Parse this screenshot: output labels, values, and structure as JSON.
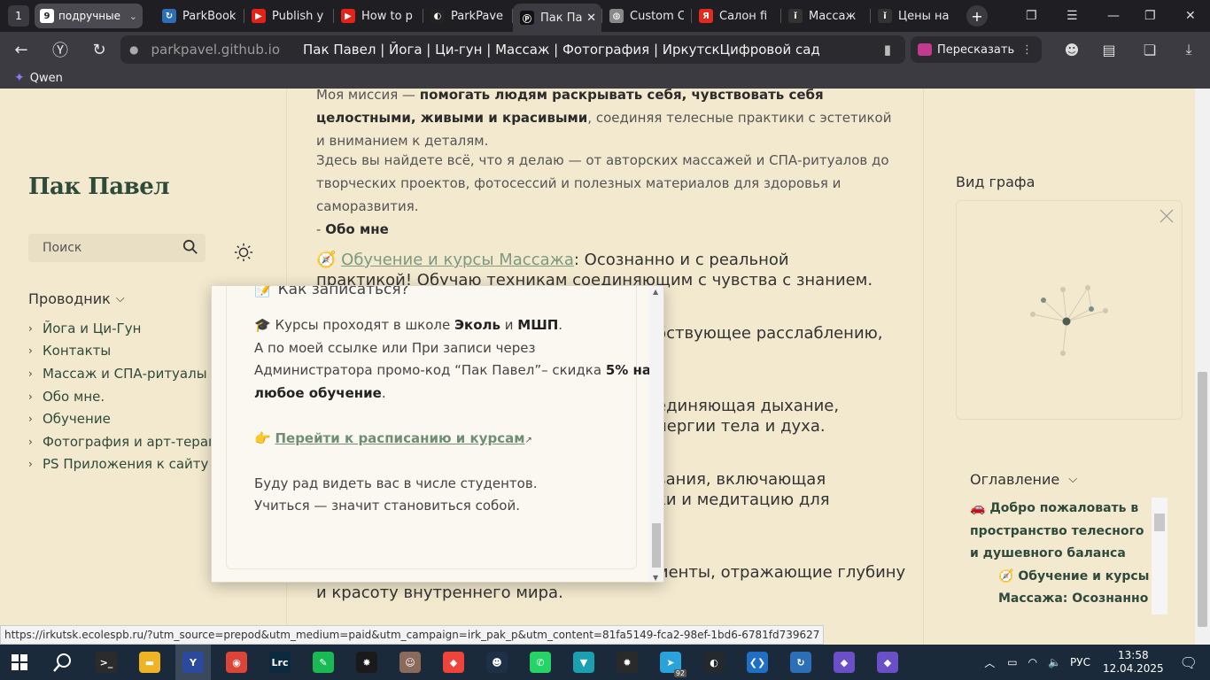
{
  "browser": {
    "tab_counter": "1",
    "group": {
      "count": "9",
      "label": "подручные"
    },
    "tabs": [
      {
        "title": "ParkBook",
        "fav_color": "#2d6fb7",
        "fav": "↻",
        "active": false
      },
      {
        "title": "Publish y",
        "fav_color": "#e62117",
        "fav": "▶",
        "active": false
      },
      {
        "title": "How to p",
        "fav_color": "#e62117",
        "fav": "▶",
        "active": false
      },
      {
        "title": "ParkPave",
        "fav_color": "#222",
        "fav": "◐",
        "active": false
      },
      {
        "title": "Пак Па",
        "fav_color": "#111",
        "fav": "Ⓟ",
        "active": true
      },
      {
        "title": "Custom C",
        "fav_color": "#888",
        "fav": "◍",
        "active": false
      },
      {
        "title": "Салон fi",
        "fav_color": "#e32a1f",
        "fav": "Я",
        "active": false
      },
      {
        "title": "Массаж",
        "fav_color": "#333",
        "fav": "ǐ",
        "active": false
      },
      {
        "title": "Цены на",
        "fav_color": "#333",
        "fav": "ǐ",
        "active": false
      }
    ],
    "address": {
      "host": "parkpavel.github.io",
      "page_title": "Пак Павел | Йога | Ци-гун | Массаж | Фотография | ИркутскЦифровой сад"
    },
    "retell_label": "Пересказать",
    "bookmark": "Qwen",
    "status_url": "https://irkutsk.ecolespb.ru/?utm_source=prepod&utm_medium=paid&utm_campaign=irk_pak_p&utm_content=81fa5149-fca2-98ef-1bd6-6781fd739627"
  },
  "sidebar": {
    "site_title": "Пак Павел",
    "search_placeholder": "Поиск",
    "explorer_label": "Проводник",
    "items": [
      {
        "label": "Йога и Ци-Гун"
      },
      {
        "label": "Контакты"
      },
      {
        "label": "Массаж и СПА-ритуалы"
      },
      {
        "label": "Обо мне."
      },
      {
        "label": "Обучение"
      },
      {
        "label": "Фотография и арт-терапия"
      },
      {
        "label": "PS Приложения к сайту"
      }
    ]
  },
  "main": {
    "p1_pre": "Моя миссия — ",
    "p1_bold": "помогать людям раскрывать себя, чувствовать себя целостными, живыми и красивыми",
    "p1_post": ", соединяя телесные практики с эстетикой и вниманием к деталям.",
    "p2": "Здесь вы найдете всё, что я делаю — от авторских массажей и СПА-ритуалов до творческих проектов, фотосессий и полезных материалов для здоровья и саморазвития.",
    "p2_link_pre": "- ",
    "p2_link": "Обо мне",
    "course_emoji": "🧭",
    "course_link": "Обучение и курсы Массажа",
    "course_rest": ": Осознанно и с реальной практикой! Обучаю техникам соединяющим с чувства с знанием.",
    "bg_lines": [
      "бствующее расслаблению,",
      "единяющая дыхание,",
      "нергии тела и духа.",
      "вания, включающая",
      "ки и медитацию для",
      "менты, отражающие глубину",
      "и красоту внутреннего мира."
    ]
  },
  "popover": {
    "heading_emoji": "📝",
    "heading": "Как записаться?",
    "l1_emoji": "🎓",
    "l1_a": "Курсы проходят в школе ",
    "l1_b1": "Эколь",
    "l1_c": " и ",
    "l1_b2": "МШП",
    "l1_d": ".",
    "l2": "А по моей ссылке или При записи через",
    "l3_a": "Администратора промо-код “Пак Павел”– скидка ",
    "l3_b": "5% на",
    "l4_b": "любое обучение",
    "l4_c": ".",
    "link_emoji": "👉",
    "link": "Перейти к расписанию и курсам",
    "l5": "Буду рад видеть вас в числе студентов.",
    "l6": "Учиться — значит становиться собой."
  },
  "right": {
    "graph_title": "Вид графа",
    "toc_title": "Оглавление",
    "toc_items": [
      {
        "emoji": "🚗",
        "text": "Добро пожаловать в пространство телесного и душевного баланса"
      },
      {
        "emoji": "🧭",
        "text": "Обучение и курсы Массажа: Осознанно и с"
      }
    ]
  },
  "taskbar": {
    "apps": [
      {
        "name": "terminal",
        "color": "#2b2b2b",
        "glyph": ">_"
      },
      {
        "name": "explorer",
        "color": "#f0b323",
        "glyph": "▬"
      },
      {
        "name": "yandex",
        "color": "#2b4a9e",
        "glyph": "Y"
      },
      {
        "name": "chrome",
        "color": "#db4437",
        "glyph": "◉"
      },
      {
        "name": "lightroom",
        "color": "#0b2a3e",
        "glyph": "Lrc"
      },
      {
        "name": "green-app",
        "color": "#19b954",
        "glyph": "✎"
      },
      {
        "name": "star-app",
        "color": "#1a1a1a",
        "glyph": "✸"
      },
      {
        "name": "photo-app",
        "color": "#8a6a5a",
        "glyph": "☺"
      },
      {
        "name": "anydesk",
        "color": "#ef443b",
        "glyph": "◆"
      },
      {
        "name": "bot-app",
        "color": "#1e3048",
        "glyph": "☻"
      },
      {
        "name": "whatsapp",
        "color": "#25d366",
        "glyph": "✆"
      },
      {
        "name": "vpn",
        "color": "#1aa0b0",
        "glyph": "▼"
      },
      {
        "name": "red-app",
        "color": "#2a2a2a",
        "glyph": "✹"
      },
      {
        "name": "telegram",
        "color": "#2aa3dd",
        "glyph": "➤"
      },
      {
        "name": "github",
        "color": "#24292e",
        "glyph": "◐"
      },
      {
        "name": "vscode",
        "color": "#1f6fc5",
        "glyph": "❮❯"
      },
      {
        "name": "sync-app",
        "color": "#2d6fb7",
        "glyph": "↻"
      },
      {
        "name": "obsidian-1",
        "color": "#6b4fc8",
        "glyph": "◆"
      },
      {
        "name": "obsidian-2",
        "color": "#6b4fc8",
        "glyph": "◆"
      }
    ],
    "telegram_badge": "92",
    "lang": "РУС",
    "time": "13:58",
    "date": "12.04.2025"
  }
}
